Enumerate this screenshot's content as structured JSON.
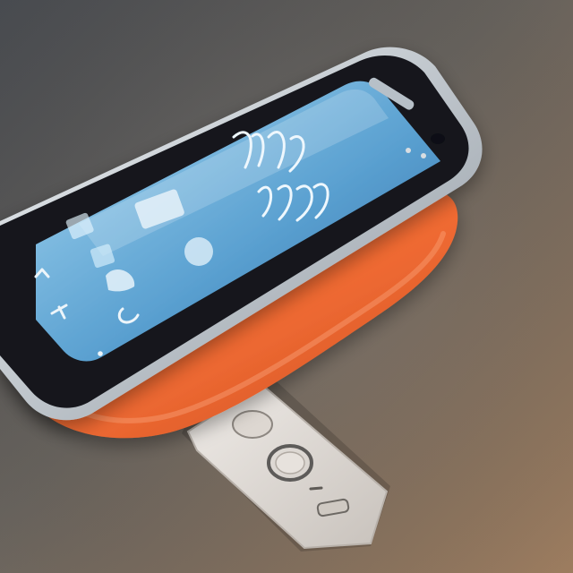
{
  "colors": {
    "surface_dark": "#4a4d52",
    "surface_mid": "#7a6d5f",
    "surface_warm": "#a07f61",
    "case_orange": "#f06a32",
    "case_orange_dark": "#c94f22",
    "phone_body": "#14181d",
    "phone_bezel": "#262c33",
    "chrome_edge": "#b9c1c8",
    "screen_top": "#9fd0ea",
    "screen_mid": "#5ba1d1",
    "screen_bottom": "#2f6ea8",
    "remote_body": "#d9d4cf",
    "remote_shadow": "#a9a39d"
  },
  "icons": {
    "phone": "smartphone-icon",
    "case": "phone-case-icon",
    "remote": "remote-control-icon",
    "back": "back-arrow-icon",
    "search": "search-icon",
    "home": "home-icon",
    "menu": "menu-icon"
  }
}
